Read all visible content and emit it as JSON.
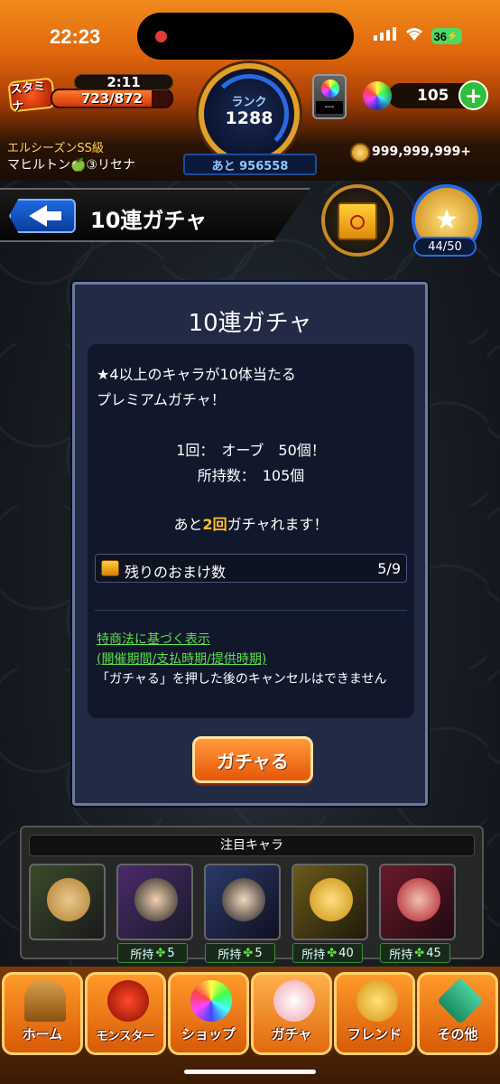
{
  "status": {
    "time": "22:23",
    "battery": "36"
  },
  "header": {
    "stamina_label": "スタミナ",
    "stamina_timer": "2:11",
    "stamina": "723/872",
    "stamina_fraction": 0.83,
    "rank_label": "ランク",
    "rank": "1288",
    "next_rank": "あと 956558",
    "player_title": "エルシーズンSS級",
    "player_name": "マヒルトン🍏③リセナ",
    "ticket_value": "---",
    "orb_count": "105",
    "plus": "+",
    "coins": "999,999,999+"
  },
  "titlebar": {
    "title": "10連ガチャ",
    "star_count": "44/50"
  },
  "dialog": {
    "title": "10連ガチャ",
    "desc_line1": "★4以上のキャラが10体当たる",
    "desc_line2": "プレミアムガチャ！",
    "cost_line1": "1回：　オーブ　50個！",
    "cost_line2": "所持数：　105個",
    "remain_pre": "あと",
    "remain_num": "2回",
    "remain_post": "ガチャれます！",
    "bonus_label": "残りのおまけ数",
    "bonus_value": "5/9",
    "legal1": "特商法に基づく表示",
    "legal2": "(開催期間/支払時期/提供時期)",
    "legal3": "「ガチャる」を押した後のキャンセルはできません",
    "button": "ガチャる"
  },
  "featured": {
    "header": "注目キャラ",
    "chars": [
      {
        "owned": ""
      },
      {
        "owned_label": "所持",
        "owned": "5"
      },
      {
        "owned_label": "所持",
        "owned": "5"
      },
      {
        "owned_label": "所持",
        "owned": "40"
      },
      {
        "owned_label": "所持",
        "owned": "45"
      }
    ]
  },
  "nav": {
    "home": "ホーム",
    "monster": "モンスター",
    "shop": "ショップ",
    "gacha": "ガチャ",
    "friend": "フレンド",
    "other": "その他"
  },
  "colors": {
    "accent": "#ffc22a",
    "legal": "#5fe04a",
    "header": "#e0660c"
  }
}
